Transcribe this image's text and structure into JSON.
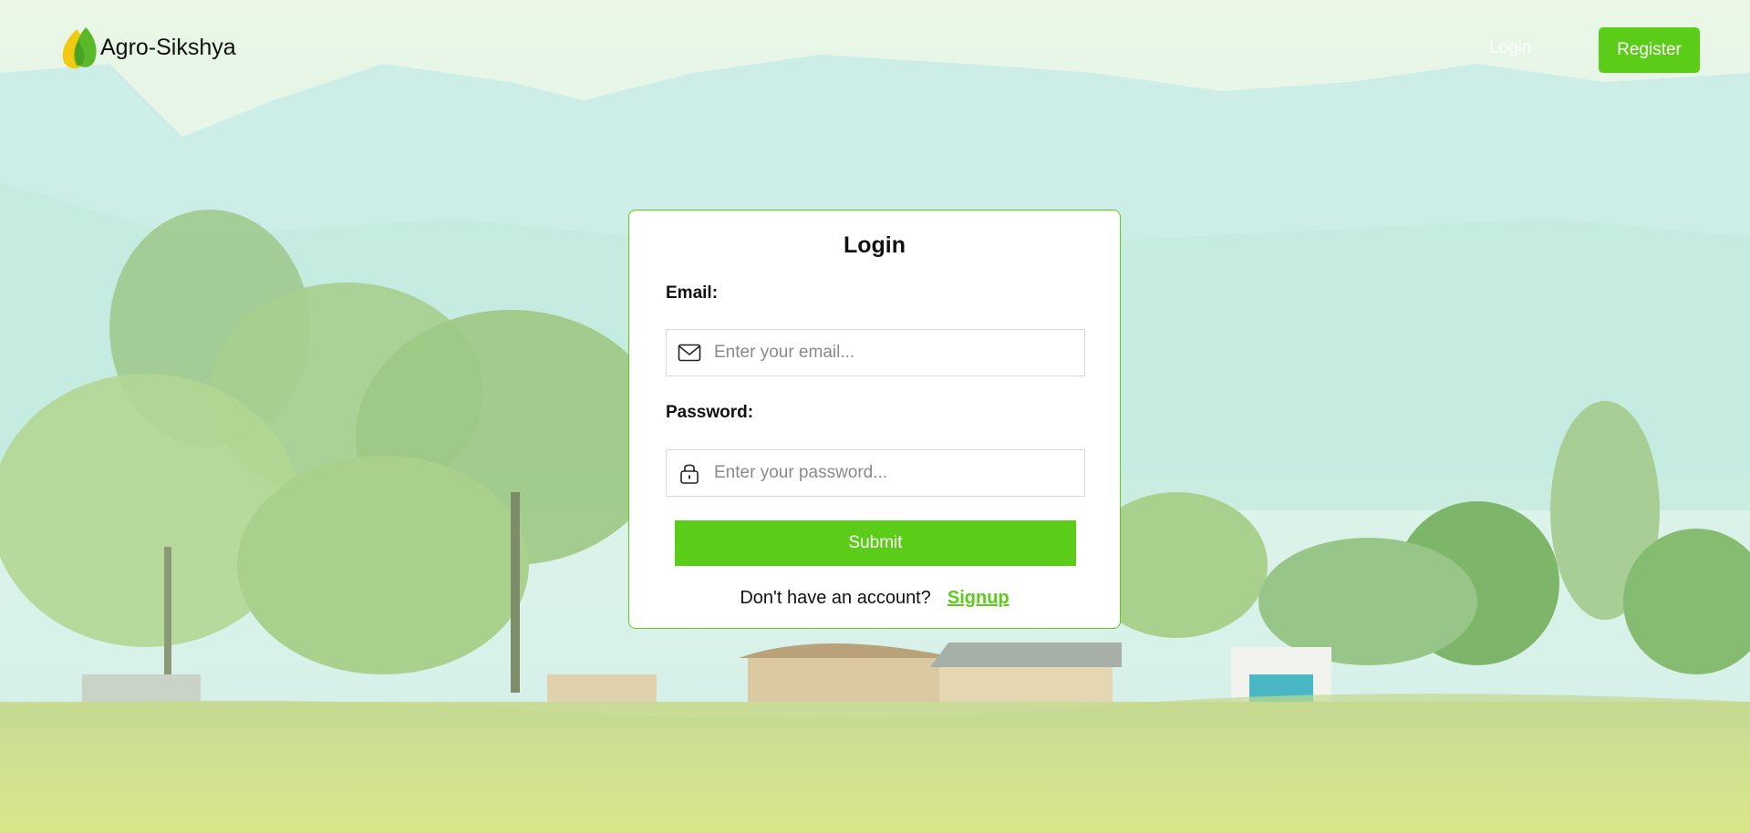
{
  "header": {
    "brand": "Agro-Sikshya",
    "nav_login": "Login",
    "register_label": "Register"
  },
  "login_form": {
    "title": "Login",
    "email_label": "Email:",
    "email_placeholder": "Enter your email...",
    "email_value": "",
    "password_label": "Password:",
    "password_placeholder": "Enter your password...",
    "password_value": "",
    "submit_label": "Submit",
    "signup_prompt": "Don't have an account?",
    "signup_link": "Signup"
  },
  "colors": {
    "accent": "#5bcd19",
    "topbar": "#3a3a3a"
  },
  "icons": {
    "logo": "leaf-logo-icon",
    "email": "envelope-icon",
    "password": "lock-icon"
  }
}
